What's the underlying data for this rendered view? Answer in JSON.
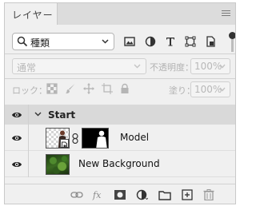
{
  "panel": {
    "tab_label": "レイヤー",
    "menu_icon": "hamburger-menu-icon"
  },
  "filter": {
    "kind_label": "種類",
    "icons": [
      "image-filter-icon",
      "adjustment-filter-icon",
      "type-filter-icon",
      "shape-filter-icon",
      "smart-object-filter-icon"
    ],
    "toggle_state": "on"
  },
  "blend": {
    "mode": "通常",
    "opacity_label": "不透明度：",
    "opacity_value": "100%"
  },
  "lock": {
    "label": "ロック：",
    "icons": [
      "lock-transparent-icon",
      "lock-image-icon",
      "lock-position-icon",
      "lock-artboard-icon",
      "lock-all-icon"
    ],
    "fill_label": "塗り：",
    "fill_value": "100%"
  },
  "layers": [
    {
      "type": "group",
      "name": "Start",
      "visible": true,
      "expanded": true
    },
    {
      "type": "smart-object",
      "name": "Model",
      "visible": true,
      "has_mask": true
    },
    {
      "type": "image",
      "name": "New Background",
      "visible": true
    }
  ],
  "footer": {
    "icons": [
      "link-layers-icon",
      "layer-style-fx-icon",
      "add-mask-icon",
      "adjustment-layer-icon",
      "new-group-icon",
      "new-layer-icon",
      "delete-layer-icon"
    ]
  },
  "colors": {
    "panel_bg": "#f0f0f0",
    "group_row_bg": "#d9d9d9",
    "tab_bar_bg": "#dcdcdc"
  }
}
